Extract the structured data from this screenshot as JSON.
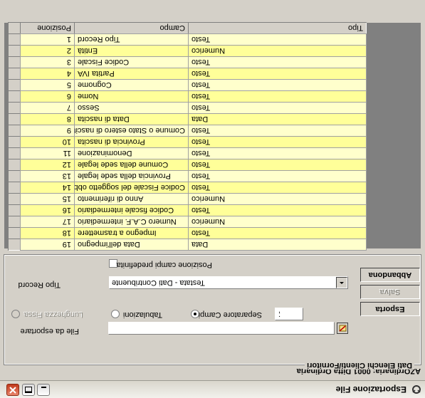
{
  "window": {
    "title": "Esportazione File",
    "company": "AZOrdinaria: 0001 Ditta Ordinaria"
  },
  "group": {
    "legend": "Dati Elenchi Clienti/Fornitori"
  },
  "buttons": {
    "esporta": "Esporta",
    "salva": "Salva",
    "abbandona": "Abbandona"
  },
  "form": {
    "file_label": "File da esportare",
    "file_value": "",
    "radio_lunghezza": "Lunghezza Fissa",
    "radio_tabulazioni": "Tabulazioni",
    "radio_separatore": "Separatore Campi",
    "separator_value": ";",
    "tipo_record_label": "Tipo Record",
    "tipo_record_value": "Testata - Dati Contribuente",
    "check_posizione": "Posizione campi predefinita"
  },
  "table": {
    "headers": {
      "posizione": "Posizione",
      "campo": "Campo",
      "tipo": "Tipo"
    },
    "rows": [
      {
        "pos": "1",
        "campo": "Tipo Record",
        "tipo": "Testo"
      },
      {
        "pos": "2",
        "campo": "Entità",
        "tipo": "Numerico"
      },
      {
        "pos": "3",
        "campo": "Codice Fiscale",
        "tipo": "Testo"
      },
      {
        "pos": "4",
        "campo": "Partita IVA",
        "tipo": "Testo"
      },
      {
        "pos": "5",
        "campo": "Cognome",
        "tipo": "Testo"
      },
      {
        "pos": "6",
        "campo": "Nome",
        "tipo": "Testo"
      },
      {
        "pos": "7",
        "campo": "Sesso",
        "tipo": "Testo"
      },
      {
        "pos": "8",
        "campo": "Data di nascita",
        "tipo": "Data"
      },
      {
        "pos": "9",
        "campo": "Comune o Stato estero di nascit",
        "tipo": "Testo"
      },
      {
        "pos": "10",
        "campo": "Provincia di nascita",
        "tipo": "Testo"
      },
      {
        "pos": "11",
        "campo": "Denominazione",
        "tipo": "Testo"
      },
      {
        "pos": "12",
        "campo": "Comune della sede legale",
        "tipo": "Testo"
      },
      {
        "pos": "13",
        "campo": "Provincia della sede legale",
        "tipo": "Testo"
      },
      {
        "pos": "14",
        "campo": "Codice Fiscale del soggetto obb",
        "tipo": "Testo"
      },
      {
        "pos": "15",
        "campo": "Anno di riferimento",
        "tipo": "Numerico"
      },
      {
        "pos": "16",
        "campo": "Codice fiscale intermediario",
        "tipo": "Testo"
      },
      {
        "pos": "17",
        "campo": "Numero C.A.F. intermediario",
        "tipo": "Numerico"
      },
      {
        "pos": "18",
        "campo": "Impegno a trasmettere",
        "tipo": "Testo"
      },
      {
        "pos": "19",
        "campo": "Data dell'impegno",
        "tipo": "Data"
      }
    ]
  }
}
